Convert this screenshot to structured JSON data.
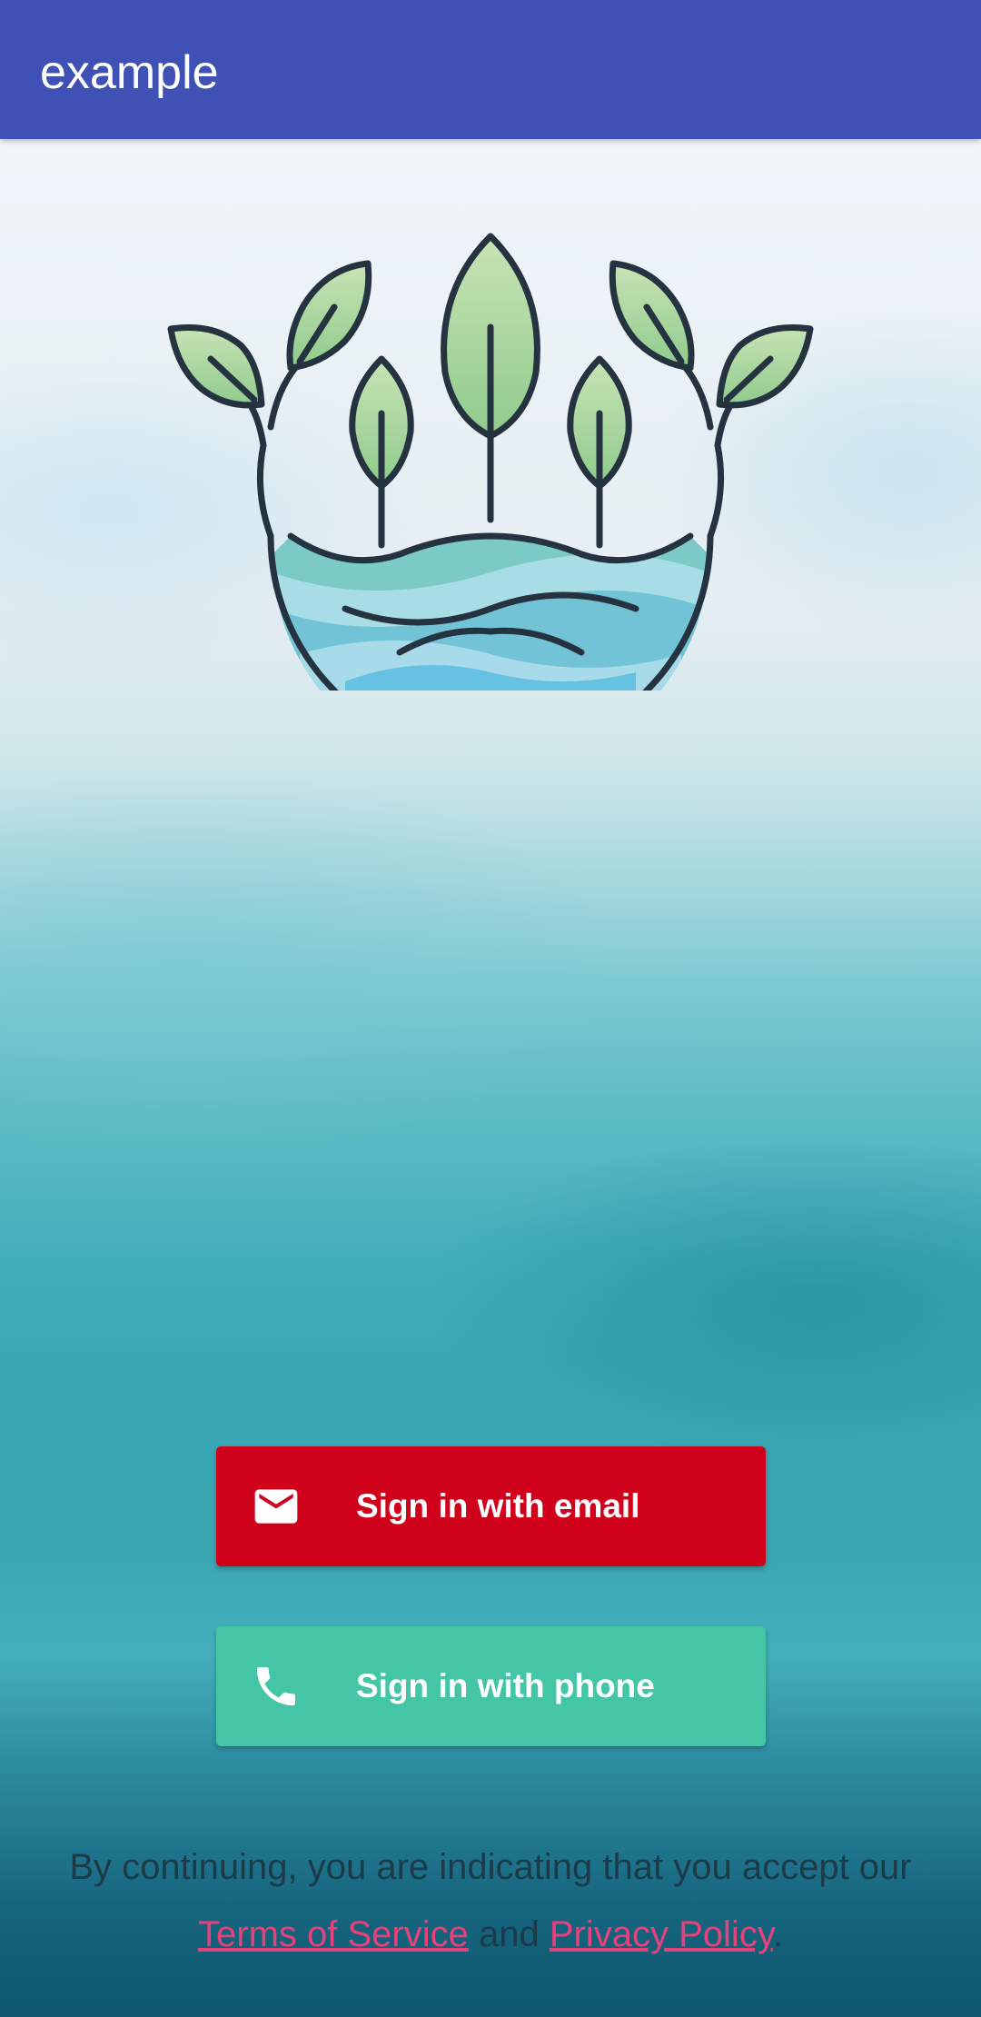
{
  "app_bar": {
    "title": "example",
    "background_color": "#3f51b5"
  },
  "logo": {
    "icon": "plant-leaves-water-logo"
  },
  "buttons": {
    "email": {
      "label": "Sign in with email",
      "icon": "email-icon",
      "color": "#d0021b"
    },
    "phone": {
      "label": "Sign in with phone",
      "icon": "phone-icon",
      "color": "#43c5a6"
    }
  },
  "terms": {
    "intro": "By continuing, you are indicating that you accept our",
    "terms_link": "Terms of Service",
    "conjunction": "and",
    "privacy_link": "Privacy Policy",
    "end": ".",
    "link_color": "#e8407b"
  }
}
